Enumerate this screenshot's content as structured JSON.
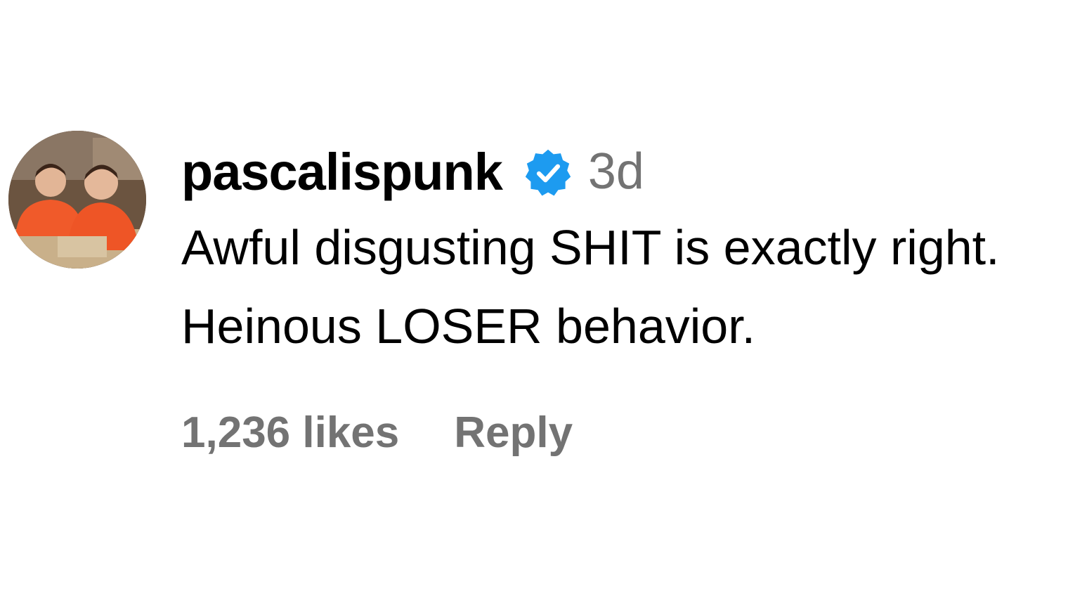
{
  "comment": {
    "avatar_icon": "profile-photo",
    "username": "pascalispunk",
    "verified_icon": "verified-badge-icon",
    "verified_color": "#1d9bf0",
    "timestamp": "3d",
    "text": "Awful disgusting SHIT is exactly right. Heinous LOSER behavior.",
    "likes": "1,236 likes",
    "reply_label": "Reply",
    "meta_color": "#737373"
  }
}
